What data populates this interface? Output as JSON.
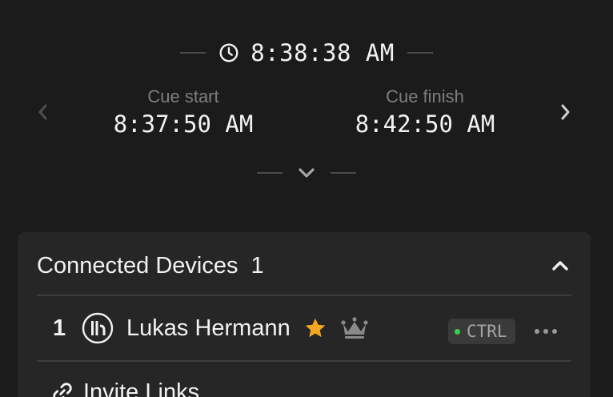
{
  "clock": {
    "time": "8:38:38 AM",
    "icon": "clock-icon"
  },
  "cue": {
    "start_label": "Cue start",
    "start_time": "8:37:50 AM",
    "finish_label": "Cue finish",
    "finish_time": "8:42:50 AM",
    "prev_icon": "chevron-left-icon",
    "next_icon": "chevron-right-icon"
  },
  "expand": {
    "icon": "chevron-down-icon"
  },
  "devices": {
    "title": "Connected Devices",
    "count": "1",
    "collapse_icon": "chevron-up-icon",
    "items": [
      {
        "index": "1",
        "name": "Lukas Hermann",
        "badge": "CTRL",
        "badge_status_color": "#3ccf4e",
        "favorite_color": "#f5a623",
        "icons": [
          "device-logo-icon",
          "star-icon",
          "crown-icon",
          "more-icon"
        ]
      }
    ]
  },
  "invite": {
    "label": "Invite Links",
    "icon": "link-icon"
  },
  "colors": {
    "background": "#1b1b1b",
    "panel": "#262626",
    "muted_text": "#7e7e7e",
    "text": "#f2f2f2",
    "accent_star": "#f5a623",
    "status_green": "#3ccf4e"
  }
}
